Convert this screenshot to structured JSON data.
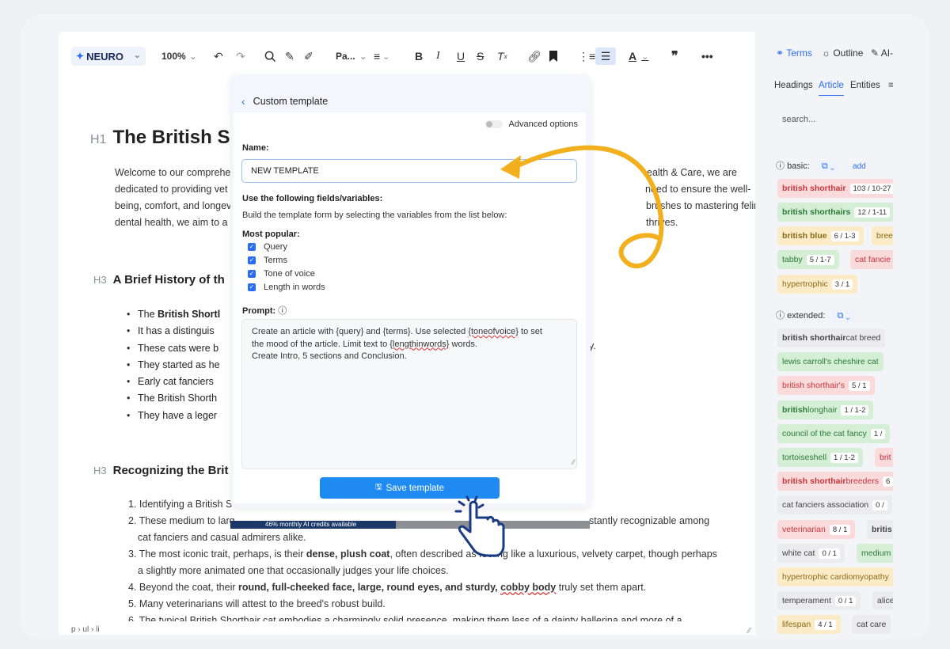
{
  "toolbar": {
    "logo": "NEURO",
    "zoom": "100%",
    "paragraph_style": "Pa..."
  },
  "document": {
    "h1_marker": "H1",
    "title": "The British S",
    "intro_lines": [
      "Welcome to our comprehe",
      "dedicated to providing vet",
      "being, comfort, and longev",
      "dental health, we aim to a"
    ],
    "intro_right_lines": [
      "ealth & Care, we are",
      "need to ensure the well-",
      "brushes to mastering feline",
      "thrives."
    ],
    "h3_marker": "H3",
    "section1_title": "A Brief History of th",
    "bullets": [
      "The British Shortl",
      "It has a distinguis",
      "These cats were b",
      "They started as he",
      "Early cat fanciers",
      "The British Shorth",
      "They have a leger"
    ],
    "bullet1_bold": "British Shortl",
    "bullet_tail": "y.",
    "section2_title": "Recognizing the Brit",
    "ordered": [
      "1. Identifying a British S",
      "2. These medium to larg",
      "cat fanciers and casual admirers alike.",
      "3. The most iconic trait, perhaps, is their ",
      "dense, plush coat",
      ", often described as feeling like a luxurious, velvety carpet, though perhaps",
      "a slightly more animated one that occasionally judges your life choices.",
      "4. Beyond the coat, their ",
      "round, full-cheeked face, large, round eyes, and sturdy, ",
      "cobby body",
      " truly set them apart.",
      "5. Many veterinarians will attest to the breed's robust build.",
      "6. The typical British Shorthair cat embodies a charmingly solid presence, making them less of a dainty ballerina and more of a"
    ],
    "ordered2_tail": "stantly recognizable among",
    "status_path": "p › ul › li"
  },
  "sidebar": {
    "tabs": [
      "Terms",
      "Outline",
      "AI-"
    ],
    "subtabs": [
      "Headings",
      "Article",
      "Entities"
    ],
    "search_placeholder": "search...",
    "basic_label": "basic:",
    "add_label": "add",
    "extended_label": "extended:",
    "basic_chips": [
      {
        "text": "british shorthair",
        "count": "103 / 10-27",
        "color": "red"
      },
      {
        "text": "british shorthairs",
        "count": "12 / 1-11",
        "color": "green"
      },
      {
        "text": "british blue",
        "count": "6 / 1-3",
        "color": "yellow"
      },
      {
        "text": "bree",
        "count": "",
        "color": "yellow"
      },
      {
        "text": "tabby",
        "count": "5 / 1-7",
        "color": "green"
      },
      {
        "text": "cat fancie",
        "count": "",
        "color": "red"
      },
      {
        "text": "hypertrophic",
        "count": "3 / 1",
        "color": "yellow"
      }
    ],
    "extended_chips": [
      {
        "bold": "british shorthair",
        "text": " cat breed",
        "count": "",
        "color": "grey"
      },
      {
        "bold": "",
        "text": "lewis carroll's cheshire cat",
        "count": "",
        "color": "green"
      },
      {
        "bold": "",
        "text": "british shorthair's",
        "count": "5 / 1",
        "color": "red"
      },
      {
        "bold": "british",
        "text": " longhair",
        "count": "1 / 1-2",
        "color": "green"
      },
      {
        "bold": "",
        "text": "council of the cat fancy",
        "count": "1 /",
        "color": "green"
      },
      {
        "bold": "",
        "text": "tortoiseshell",
        "count": "1 / 1-2",
        "color": "green"
      },
      {
        "bold": "",
        "text": "brit",
        "count": "",
        "color": "red"
      },
      {
        "bold": "british shorthair",
        "text": " breeders",
        "count": "6",
        "color": "red"
      },
      {
        "bold": "",
        "text": "cat fanciers association",
        "count": "0 /",
        "color": "grey"
      },
      {
        "bold": "",
        "text": "veterinarian",
        "count": "8 / 1",
        "color": "red"
      },
      {
        "bold": "",
        "text": "britis",
        "count": "",
        "color": "grey"
      },
      {
        "bold": "",
        "text": "white cat",
        "count": "0 / 1",
        "color": "grey"
      },
      {
        "bold": "",
        "text": "medium",
        "count": "",
        "color": "green"
      },
      {
        "bold": "",
        "text": "hypertrophic cardiomyopathy",
        "count": "",
        "color": "yellow"
      },
      {
        "bold": "",
        "text": "temperament",
        "count": "0 / 1",
        "color": "grey"
      },
      {
        "bold": "",
        "text": "alice",
        "count": "",
        "color": "grey"
      },
      {
        "bold": "",
        "text": "lifespan",
        "count": "4 / 1",
        "color": "yellow"
      },
      {
        "bold": "",
        "text": "cat care",
        "count": "",
        "color": "grey"
      }
    ]
  },
  "modal": {
    "title": "Custom template",
    "advanced": "Advanced options",
    "name_label": "Name:",
    "name_value": "NEW TEMPLATE",
    "fields_label": "Use the following fields/variables:",
    "fields_hint": "Build the template form by selecting the variables from the list below:",
    "popular_label": "Most popular:",
    "checks": [
      "Query",
      "Terms",
      "Tone of voice",
      "Length in words"
    ],
    "prompt_label": "Prompt:",
    "prompt_lines": [
      [
        "Create an article with {query} and {terms}. Use selected ",
        "{toneofvoice}",
        " to set"
      ],
      [
        "the mood of the article. Limit text to ",
        "{lengthinwords}",
        " words."
      ],
      [
        "Create Intro, 5 sections and Conclusion.",
        "",
        ""
      ]
    ],
    "save_label": "Save template"
  },
  "credits": {
    "text": "46% monthly AI credits available",
    "fraction": 0.46
  },
  "colors": {
    "accent": "#2b6cf6",
    "annotation": "#f2b01e"
  }
}
